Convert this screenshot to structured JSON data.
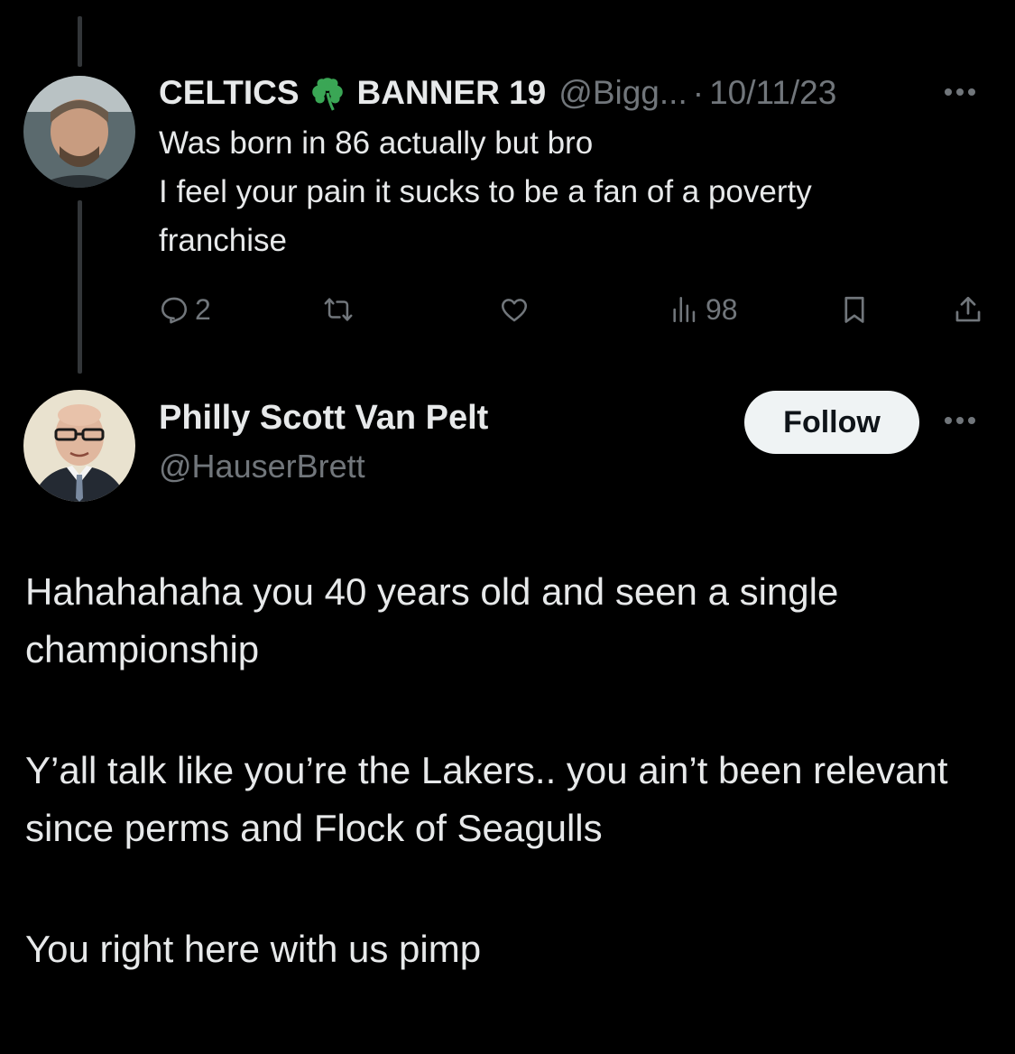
{
  "reply_tweet": {
    "display_name_part1": "CELTICS",
    "emoji_icon": "shamrock-icon",
    "display_name_part2": "BANNER 19",
    "handle": "@Bigg...",
    "separator": "·",
    "date": "10/11/23",
    "text_lines": [
      "Was born in 86 actually but bro",
      "I feel your pain it sucks to be a fan of a poverty",
      "franchise"
    ],
    "actions": {
      "reply_count": "2",
      "retweet_count": "",
      "like_count": "",
      "views_count": "98"
    }
  },
  "main_tweet": {
    "display_name": "Philly Scott Van Pelt",
    "handle": "@HauserBrett",
    "follow_label": "Follow",
    "paragraphs": [
      "Hahahahaha you 40 years old and seen a single championship",
      "Y’all talk like you’re the Lakers.. you ain’t been relevant since perms and Flock of Seagulls",
      "You right here with us pimp"
    ]
  },
  "colors": {
    "background": "#000000",
    "primary_text": "#e7e9ea",
    "secondary_text": "#71767b",
    "follow_button_bg": "#eff3f4",
    "shamrock": "#3aa655"
  }
}
